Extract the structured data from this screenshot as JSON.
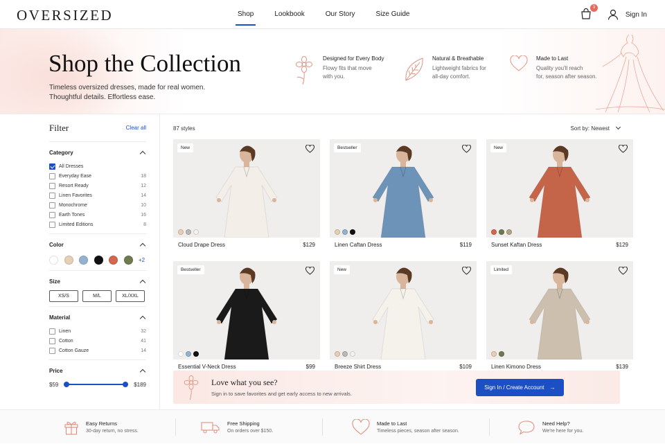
{
  "brand": {
    "logo": "OVERSIZED"
  },
  "nav": {
    "items": [
      "Shop",
      "Lookbook",
      "Our Story",
      "Size Guide"
    ],
    "active": "Shop"
  },
  "header": {
    "cart_count": "3",
    "sign_in": "Sign In"
  },
  "hero": {
    "title": "Shop the Collection",
    "subtitle_line1": "Timeless oversized dresses, made for real women.",
    "subtitle_line2": "Thoughtful details. Effortless ease.",
    "features": [
      {
        "icon": "flower-icon",
        "title": "Designed for Every Body",
        "desc1": "Flowy fits that move",
        "desc2": "with you."
      },
      {
        "icon": "leaf-icon",
        "title": "Natural & Breathable",
        "desc1": "Lightweight fabrics for",
        "desc2": "all-day comfort."
      },
      {
        "icon": "heart-icon",
        "title": "Made to Last",
        "desc1": "Quality you'll reach",
        "desc2": "for, season after season."
      }
    ]
  },
  "filter": {
    "title": "Filter",
    "clear_all": "Clear all",
    "category": {
      "title": "Category",
      "items": [
        {
          "label": "All Dresses",
          "count": "",
          "checked": true
        },
        {
          "label": "Everyday Ease",
          "count": "18",
          "checked": false
        },
        {
          "label": "Resort Ready",
          "count": "12",
          "checked": false
        },
        {
          "label": "Linen Favorites",
          "count": "14",
          "checked": false
        },
        {
          "label": "Monochrome",
          "count": "10",
          "checked": false
        },
        {
          "label": "Earth Tones",
          "count": "16",
          "checked": false
        },
        {
          "label": "Limited Editions",
          "count": "8",
          "checked": false
        }
      ]
    },
    "color": {
      "title": "Color",
      "swatches": [
        "#ffffff",
        "#e6cfb4",
        "#94b2cf",
        "#111111",
        "#d4674f",
        "#6f7a4e"
      ],
      "more": "+2"
    },
    "size": {
      "title": "Size",
      "options": [
        "XS/S",
        "M/L",
        "XL/XXL"
      ]
    },
    "material": {
      "title": "Material",
      "items": [
        {
          "label": "Linen",
          "count": "32"
        },
        {
          "label": "Cotton",
          "count": "41"
        },
        {
          "label": "Cotton Gauze",
          "count": "14"
        }
      ]
    },
    "price": {
      "title": "Price",
      "min": "$59",
      "max": "$189"
    }
  },
  "listing": {
    "count": "87 styles",
    "sort": "Sort by: Newest"
  },
  "products": [
    {
      "name": "Cloud Drape Dress",
      "price": "$129",
      "badge": "New",
      "dress_color": "#f3efe8",
      "colors": [
        "#e6cfb4",
        "#b9b9b9",
        "#f4f2ee"
      ]
    },
    {
      "name": "Linen Caftan Dress",
      "price": "$119",
      "badge": "Bestseller",
      "dress_color": "#6e93b9",
      "colors": [
        "#e6cfb4",
        "#94b2cf",
        "#111111"
      ]
    },
    {
      "name": "Sunset Kaftan Dress",
      "price": "$129",
      "badge": "New",
      "dress_color": "#c4654a",
      "colors": [
        "#d4674f",
        "#6f7a4e",
        "#b3a486"
      ]
    },
    {
      "name": "Essential V-Neck Dress",
      "price": "$99",
      "badge": "Bestseller",
      "dress_color": "#1a1a1a",
      "colors": [
        "#ffffff",
        "#94b2cf",
        "#111111"
      ]
    },
    {
      "name": "Breeze Shirt Dress",
      "price": "$109",
      "badge": "New",
      "dress_color": "#f5f2ec",
      "colors": [
        "#e6cfb4",
        "#b9b9b9",
        "#f4f2ee"
      ]
    },
    {
      "name": "Linen Kimono Dress",
      "price": "$139",
      "badge": "Limited",
      "dress_color": "#cdbfae",
      "colors": [
        "#e6cfb4",
        "#6f7a4e"
      ]
    }
  ],
  "banner": {
    "title": "Love what you see?",
    "subtitle": "Sign in to save favorites and get early access to new arrivals.",
    "cta": "Sign In / Create Account"
  },
  "footer": [
    {
      "icon": "gift-icon",
      "title": "Easy Returns",
      "desc": "30-day return, no stress."
    },
    {
      "icon": "truck-icon",
      "title": "Free Shipping",
      "desc": "On orders over $150."
    },
    {
      "icon": "heart-icon",
      "title": "Made to Last",
      "desc": "Timeless pieces, season after season."
    },
    {
      "icon": "chat-icon",
      "title": "Need Help?",
      "desc": "We're here for you."
    }
  ]
}
